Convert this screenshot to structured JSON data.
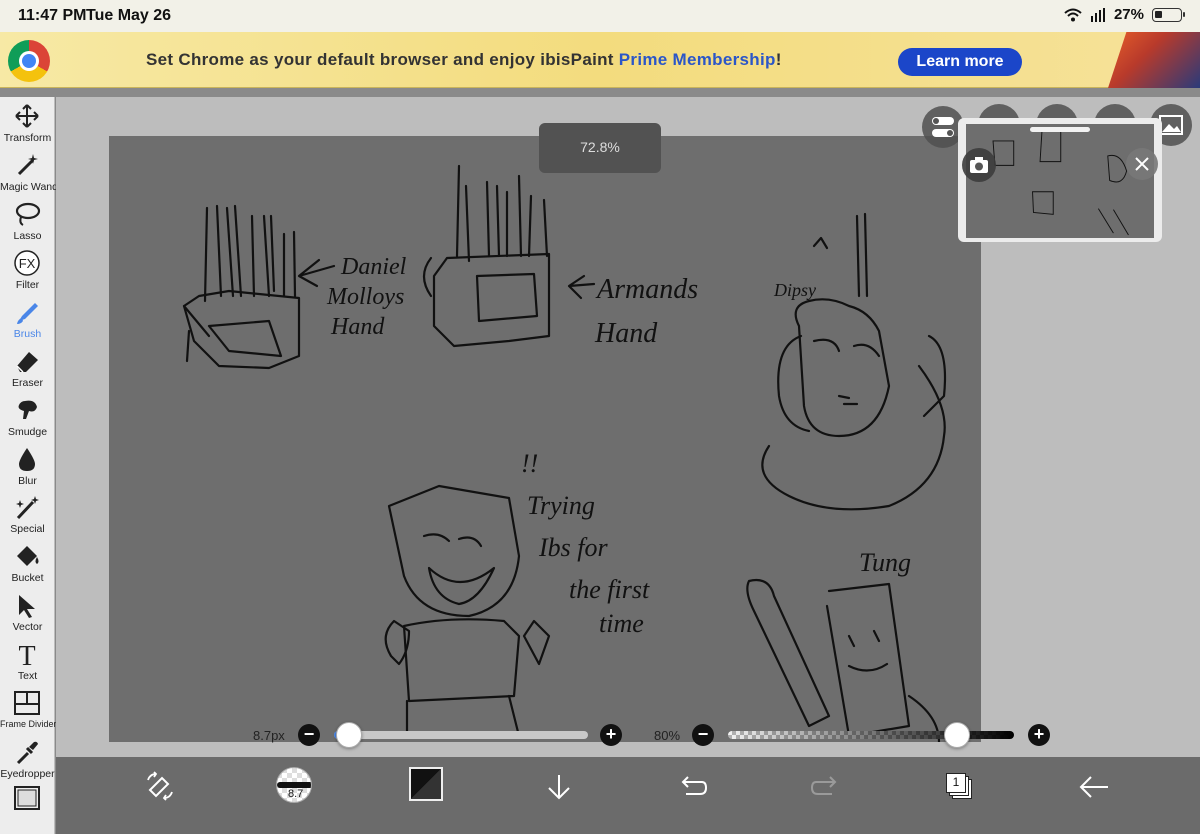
{
  "status_bar": {
    "time": "11:47 PM",
    "date": "Tue May 26",
    "battery": "27%",
    "battery_level": 0.27
  },
  "banner": {
    "msg_pre": "Set Chrome as your default browser and enjoy ibisPaint ",
    "msg_highlight": "Prime Membership",
    "msg_post": "!",
    "button": "Learn more"
  },
  "tools": [
    {
      "id": "transform",
      "label": "Transform",
      "icon": "move-arrows-icon"
    },
    {
      "id": "magic-wand",
      "label": "Magic Wand",
      "icon": "magic-wand-icon"
    },
    {
      "id": "lasso",
      "label": "Lasso",
      "icon": "lasso-icon"
    },
    {
      "id": "filter",
      "label": "Filter",
      "icon": "fx-icon",
      "glyph": "FX"
    },
    {
      "id": "brush",
      "label": "Brush",
      "icon": "brush-icon",
      "active": true
    },
    {
      "id": "eraser",
      "label": "Eraser",
      "icon": "eraser-icon"
    },
    {
      "id": "smudge",
      "label": "Smudge",
      "icon": "smudge-icon"
    },
    {
      "id": "blur",
      "label": "Blur",
      "icon": "drop-icon"
    },
    {
      "id": "special",
      "label": "Special",
      "icon": "sparkle-pen-icon"
    },
    {
      "id": "bucket",
      "label": "Bucket",
      "icon": "bucket-icon"
    },
    {
      "id": "vector",
      "label": "Vector",
      "icon": "cursor-arrow-icon"
    },
    {
      "id": "text",
      "label": "Text",
      "icon": "text-icon",
      "glyph": "T"
    },
    {
      "id": "frame-divider",
      "label": "Frame Divider",
      "icon": "frame-divider-icon"
    },
    {
      "id": "eyedropper",
      "label": "Eyedropper",
      "icon": "eyedropper-icon"
    },
    {
      "id": "canvas",
      "label": "",
      "icon": "canvas-frame-icon"
    }
  ],
  "canvas": {
    "zoom": "72.8%",
    "sketch_texts": {
      "t1": "Daniel",
      "t2": "Molloys",
      "t3": "Hand",
      "t4": "Armands",
      "t5": "Hand",
      "t6": "Dipsy",
      "t7": "!!",
      "t8": "Trying",
      "t9": "Ibs for",
      "t10": "the first",
      "t11": "time",
      "t12": "Tung"
    }
  },
  "sliders": {
    "brush_size": {
      "label": "8.7px",
      "minus": "−",
      "plus": "+",
      "value": 0.06
    },
    "opacity": {
      "label": "80%",
      "minus": "−",
      "plus": "+",
      "value": 0.8
    }
  },
  "bottom_bar": {
    "brush_size_short": "8.7",
    "layer_count": "1",
    "icons": [
      "swap-tools-icon",
      "brush-preview-icon",
      "color-swatch-icon",
      "download-arrow-icon",
      "undo-icon",
      "redo-icon",
      "layers-icon",
      "back-arrow-icon"
    ]
  },
  "colors": {
    "canvas_bg": "#6e6e6e",
    "accent": "#4a86e8",
    "banner_button": "#1b46c9"
  }
}
